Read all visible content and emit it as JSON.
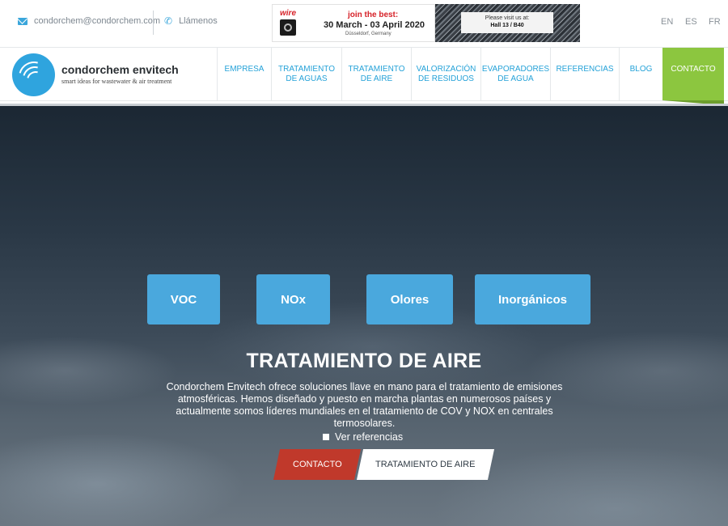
{
  "topbar": {
    "email": "condorchem@condorchem.com",
    "phone_label": "Llámenos",
    "languages": [
      "EN",
      "ES",
      "FR"
    ]
  },
  "banner": {
    "logo_word": "wire",
    "tagline": "join the best:",
    "dates": "30 March - 03 April 2020",
    "city": "Düsseldorf, Germany",
    "visit_line": "Please visit us at:",
    "hall": "Hall 13 / B40"
  },
  "brand": {
    "name": "condorchem envitech",
    "tagline": "smart ideas for wastewater & air treatment"
  },
  "nav": {
    "items": [
      {
        "label": "EMPRESA"
      },
      {
        "label": "TRATAMIENTO DE AGUAS"
      },
      {
        "label": "TRATAMIENTO DE AIRE"
      },
      {
        "label": "VALORIZACIÓN DE RESIDUOS"
      },
      {
        "label": "EVAPORADORES DE AGUA"
      },
      {
        "label": "REFERENCIAS"
      },
      {
        "label": "BLOG"
      }
    ],
    "contact": "CONTACTO"
  },
  "hero": {
    "categories": [
      "VOC",
      "NOx",
      "Olores",
      "Inorgánicos"
    ],
    "title": "TRATAMIENTO DE AIRE",
    "description": "Condorchem Envitech ofrece soluciones llave en mano para el tratamiento de emisiones atmosféricas. Hemos diseñado y puesto en marcha plantas en numerosos países y actualmente somos líderes mundiales en el tratamiento de COV y NOX en centrales termosolares.",
    "link_label": "Ver referencias",
    "cta_primary": "CONTACTO",
    "cta_secondary": "TRATAMIENTO DE AIRE"
  },
  "colors": {
    "brand_blue": "#2fa4de",
    "contact_green": "#8cc63f",
    "category_blue": "#4aa8dd",
    "cta_red": "#c0392b"
  },
  "icons": {
    "email": "envelope-icon",
    "phone": "phone-icon",
    "link": "square-icon"
  }
}
